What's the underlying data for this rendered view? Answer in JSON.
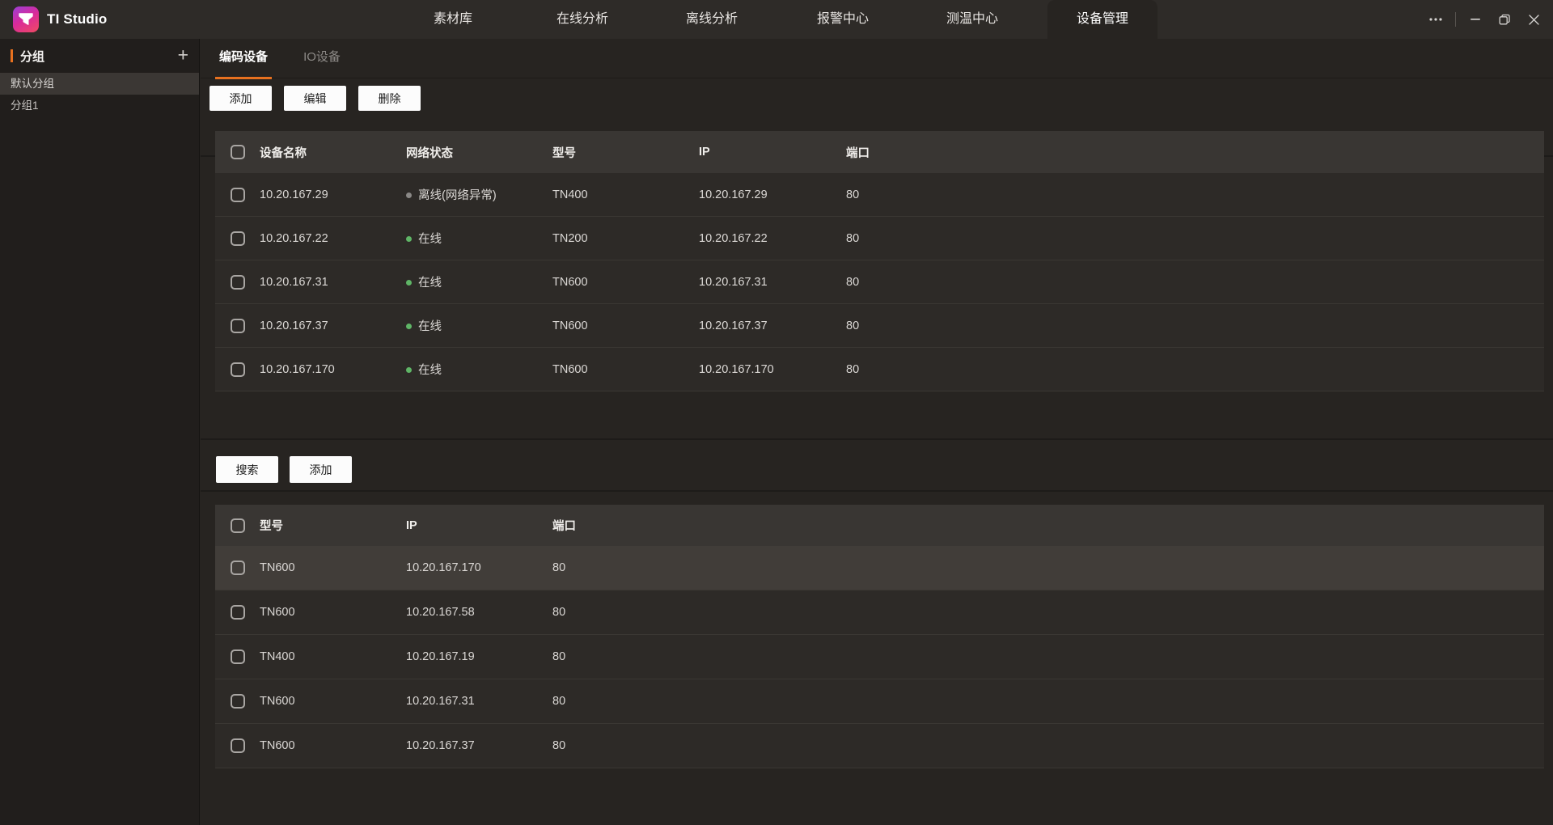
{
  "app": {
    "title": "TI Studio",
    "accent_color": "#e8711f",
    "nav_tabs": [
      {
        "label": "素材库",
        "active": false
      },
      {
        "label": "在线分析",
        "active": false
      },
      {
        "label": "离线分析",
        "active": false
      },
      {
        "label": "报警中心",
        "active": false
      },
      {
        "label": "测温中心",
        "active": false
      },
      {
        "label": "设备管理",
        "active": true
      }
    ],
    "window_controls": {
      "more": "more",
      "minimize": "minimize",
      "maximize": "restore",
      "close": "close"
    }
  },
  "sidebar": {
    "header": "分组",
    "add_icon": "+",
    "items": [
      {
        "label": "默认分组",
        "selected": true
      },
      {
        "label": "分组1",
        "selected": false
      }
    ]
  },
  "content": {
    "tabs": [
      {
        "label": "编码设备",
        "active": true
      },
      {
        "label": "IO设备",
        "active": false
      }
    ],
    "device_toolbar": {
      "add": "添加",
      "edit": "编辑",
      "delete": "删除"
    },
    "device_table": {
      "columns": [
        "设备名称",
        "网络状态",
        "型号",
        "IP",
        "端口"
      ],
      "rows": [
        {
          "name": "10.20.167.29",
          "status": "离线(网络异常)",
          "online": false,
          "model": "TN400",
          "ip": "10.20.167.29",
          "port": "80"
        },
        {
          "name": "10.20.167.22",
          "status": "在线",
          "online": true,
          "model": "TN200",
          "ip": "10.20.167.22",
          "port": "80"
        },
        {
          "name": "10.20.167.31",
          "status": "在线",
          "online": true,
          "model": "TN600",
          "ip": "10.20.167.31",
          "port": "80"
        },
        {
          "name": "10.20.167.37",
          "status": "在线",
          "online": true,
          "model": "TN600",
          "ip": "10.20.167.37",
          "port": "80"
        },
        {
          "name": "10.20.167.170",
          "status": "在线",
          "online": true,
          "model": "TN600",
          "ip": "10.20.167.170",
          "port": "80"
        }
      ]
    },
    "search_toolbar": {
      "search": "搜索",
      "add": "添加"
    },
    "search_table": {
      "columns": [
        "型号",
        "IP",
        "端口"
      ],
      "rows": [
        {
          "model": "TN600",
          "ip": "10.20.167.170",
          "port": "80",
          "highlighted": true
        },
        {
          "model": "TN600",
          "ip": "10.20.167.58",
          "port": "80",
          "highlighted": false
        },
        {
          "model": "TN400",
          "ip": "10.20.167.19",
          "port": "80",
          "highlighted": false
        },
        {
          "model": "TN600",
          "ip": "10.20.167.31",
          "port": "80",
          "highlighted": false
        },
        {
          "model": "TN600",
          "ip": "10.20.167.37",
          "port": "80",
          "highlighted": false
        }
      ]
    },
    "status_colors": {
      "online": "#5fb566",
      "offline": "#8a8886"
    }
  }
}
